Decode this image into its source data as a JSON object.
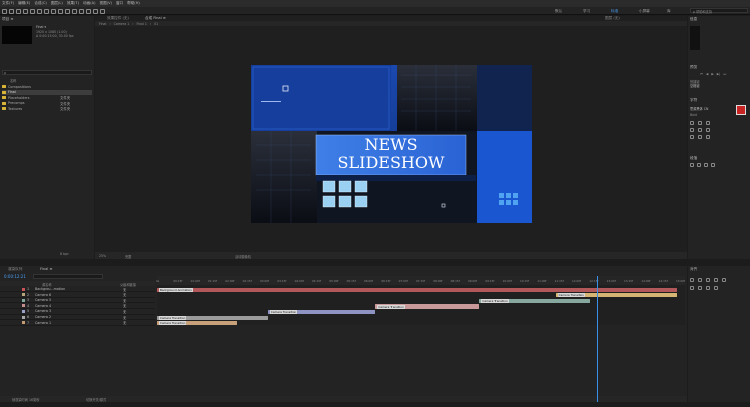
{
  "menu": [
    "文件(F)",
    "编辑(E)",
    "合成(C)",
    "图层(L)",
    "效果(T)",
    "动画(A)",
    "视图(V)",
    "窗口",
    "帮助(H)"
  ],
  "workspaces": [
    {
      "label": "默认",
      "active": false
    },
    {
      "label": "学习",
      "active": false
    },
    {
      "label": "标准",
      "active": true
    },
    {
      "label": "小屏幕",
      "active": false
    },
    {
      "label": "库",
      "active": false
    }
  ],
  "project_panel": {
    "tab": "项目 ≡",
    "preview_name": "Final ▾",
    "preview_info_1": "1920 x 1080 (1.00)",
    "preview_info_2": "Δ 0:00:15:00, 30.00 fps",
    "search_placeholder": "ρ",
    "col_name": "名称",
    "items": [
      {
        "name": "Compositions",
        "size": "",
        "selected": false
      },
      {
        "name": "Final",
        "size": "",
        "selected": true
      },
      {
        "name": "Placeholders",
        "size": "文件夹",
        "selected": false
      },
      {
        "name": "Precomps",
        "size": "文件夹",
        "selected": false
      },
      {
        "name": "Textures",
        "size": "文件夹",
        "selected": false
      }
    ],
    "footer_bpc": "8 bpc"
  },
  "viewer": {
    "tabs": [
      "效果控件 (无)",
      "合成 Final ≡",
      "图层 (无)"
    ],
    "breadcrumbs": [
      "Final",
      "Camera 1",
      "Final 1",
      "01"
    ],
    "zoom": "25%",
    "resolution": "完整",
    "view_name": "活动摄像机",
    "title_line_1": "NEWS",
    "title_line_2": "SLIDESHOW"
  },
  "timeline": {
    "tabs": [
      "渲染队列",
      "Final ≡"
    ],
    "timecode": "0:00:12:21",
    "col_source": "源名称",
    "col_parent": "父级和链接",
    "footer_left": "帧渲染时间 16毫秒",
    "footer_mid": "切换开关/模式",
    "layers": [
      {
        "num": "1",
        "name": "Backgrou...mation",
        "color": "#c8545a",
        "parent": "无"
      },
      {
        "num": "2",
        "name": "Camera 6",
        "color": "#b6a47a",
        "parent": "无"
      },
      {
        "num": "3",
        "name": "Camera 5",
        "color": "#7fa89a",
        "parent": "无"
      },
      {
        "num": "4",
        "name": "Camera 4",
        "color": "#c48e8e",
        "parent": "无"
      },
      {
        "num": "5",
        "name": "Camera 3",
        "color": "#9aa0c8",
        "parent": "无"
      },
      {
        "num": "6",
        "name": "Camera 2",
        "color": "#a7a7a7",
        "parent": "无"
      },
      {
        "num": "7",
        "name": "Camera 1",
        "color": "#c39b74",
        "parent": "无"
      }
    ],
    "bars": [
      {
        "label": "Background Animation",
        "color": "#b2585a",
        "start": 0,
        "end": 15
      },
      {
        "label": "Camera Transition",
        "color": "#d6b574",
        "start": 11.5,
        "end": 15
      },
      {
        "label": "Camera Transition",
        "color": "#86a89f",
        "start": 9.3,
        "end": 12.5
      },
      {
        "label": "Camera Transition",
        "color": "#c9999a",
        "start": 6.3,
        "end": 9.3
      },
      {
        "label": "Camera Transition",
        "color": "#8f93c2",
        "start": 3.2,
        "end": 6.3
      },
      {
        "label": "Camera Transition",
        "color": "#9b9b9b",
        "start": 0,
        "end": 3.2
      },
      {
        "label": "Camera Transition",
        "color": "#c8a17a",
        "start": 0,
        "end": 2.3
      }
    ],
    "ruler_labels": [
      "0s",
      "00:15f",
      "01:00f",
      "01:15f",
      "02:00f",
      "02:15f",
      "03:00f",
      "03:15f",
      "04:00f",
      "04:15f",
      "05:00f",
      "05:15f",
      "06:00f",
      "06:15f",
      "07:00f",
      "07:15f",
      "08:00f",
      "08:15f",
      "09:00f",
      "09:15f",
      "10:00f",
      "10:15f",
      "11:00f",
      "11:15f",
      "12:00f",
      "12:15f",
      "13:00f",
      "13:15f",
      "14:00f",
      "14:15f",
      "15:00f"
    ],
    "playhead_seconds": 12.7
  },
  "right_panel": {
    "tab_info": "信息",
    "tab_preview": "预览",
    "preview_label": "快捷键",
    "preview_value": "空格键",
    "tab_character": "字符",
    "font_name": "思源黑体 CN",
    "font_style": "Bold",
    "tab_align": "对齐",
    "tab_paragraph": "段落",
    "search_label": "ρ 帮助和支持"
  }
}
